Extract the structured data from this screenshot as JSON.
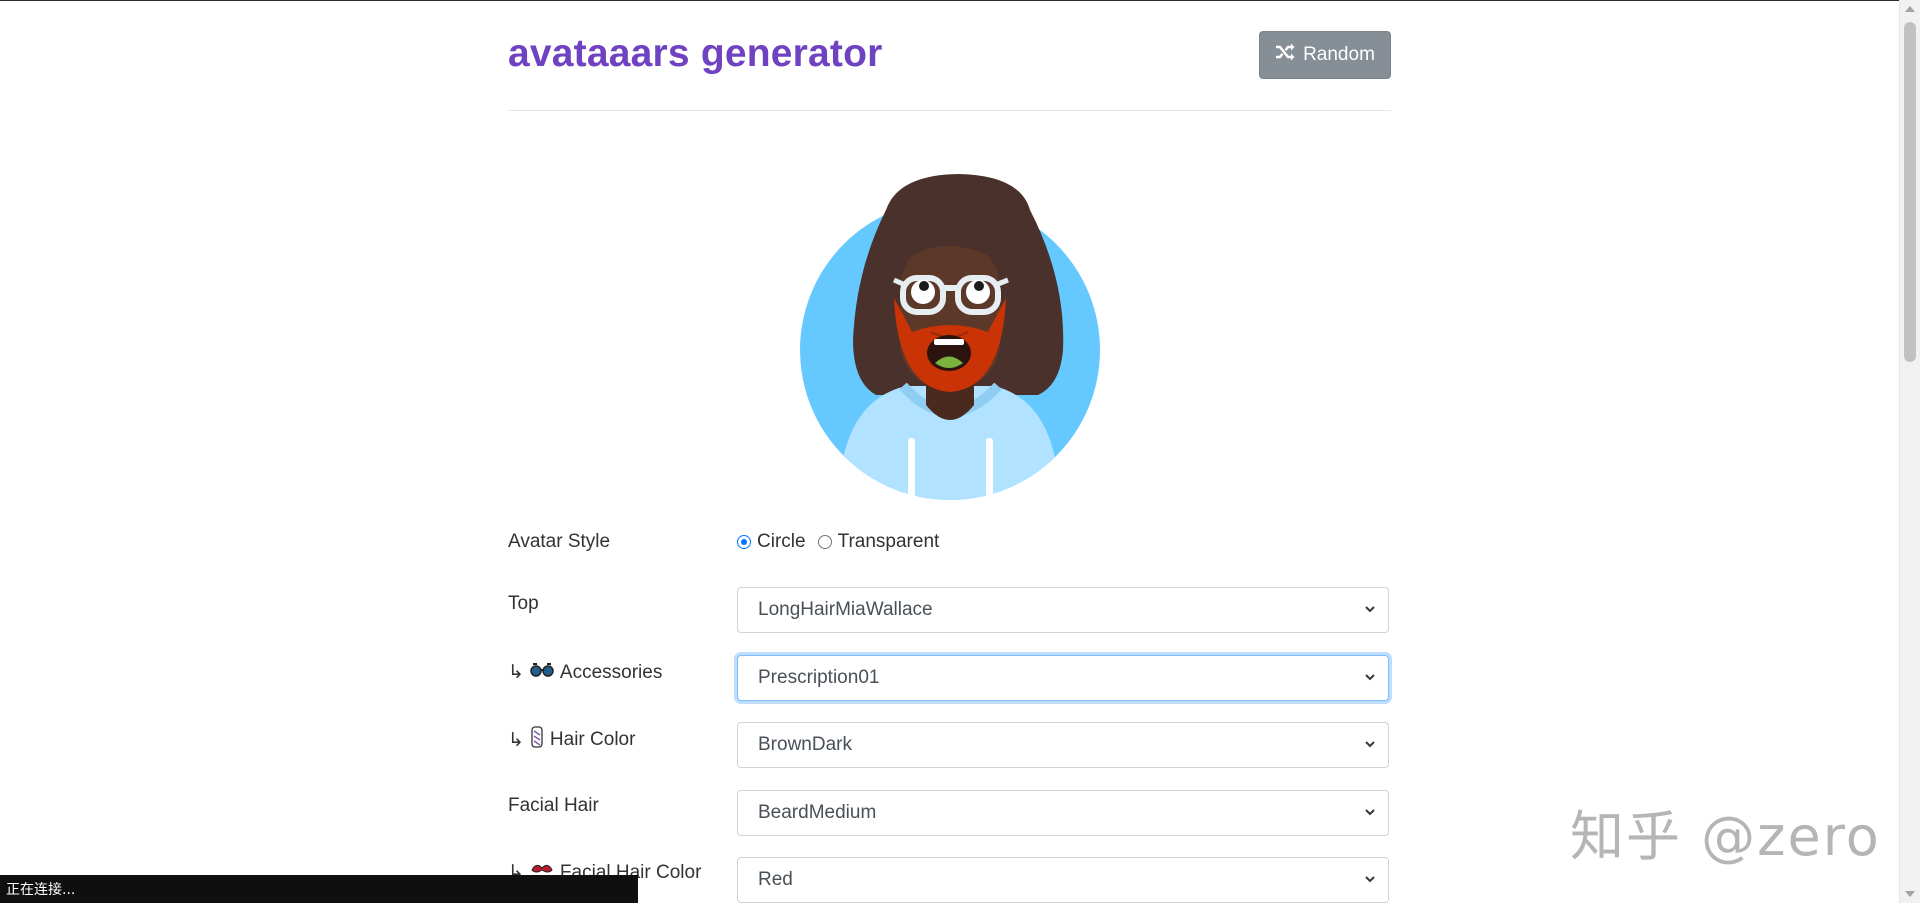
{
  "header": {
    "title": "avataaars generator",
    "random_label": "Random"
  },
  "form": {
    "avatar_style": {
      "label": "Avatar Style",
      "options": [
        "Circle",
        "Transparent"
      ],
      "selected": "Circle"
    },
    "top": {
      "label": "Top",
      "value": "LongHairMiaWallace"
    },
    "accessories": {
      "prefix": "↳",
      "icon": "glasses-icon",
      "label": "Accessories",
      "value": "Prescription01"
    },
    "hair_color": {
      "prefix": "↳",
      "icon": "hair-color-icon",
      "label": "Hair Color",
      "value": "BrownDark"
    },
    "facial_hair": {
      "label": "Facial Hair",
      "value": "BeardMedium"
    },
    "facial_hair_color": {
      "prefix": "↳",
      "icon": "facial-hair-icon",
      "label": "Facial Hair Color",
      "value": "Red"
    }
  },
  "watermark": "知乎 @zero",
  "status_bar": "正在连接...",
  "colors": {
    "title": "#6f42c1",
    "random_button": "#868e96",
    "avatar_bg": "#65c9ff",
    "hair": "#4a312c",
    "beard": "#c93305",
    "skin": "#5c3829",
    "shirt": "#b1e2ff"
  }
}
